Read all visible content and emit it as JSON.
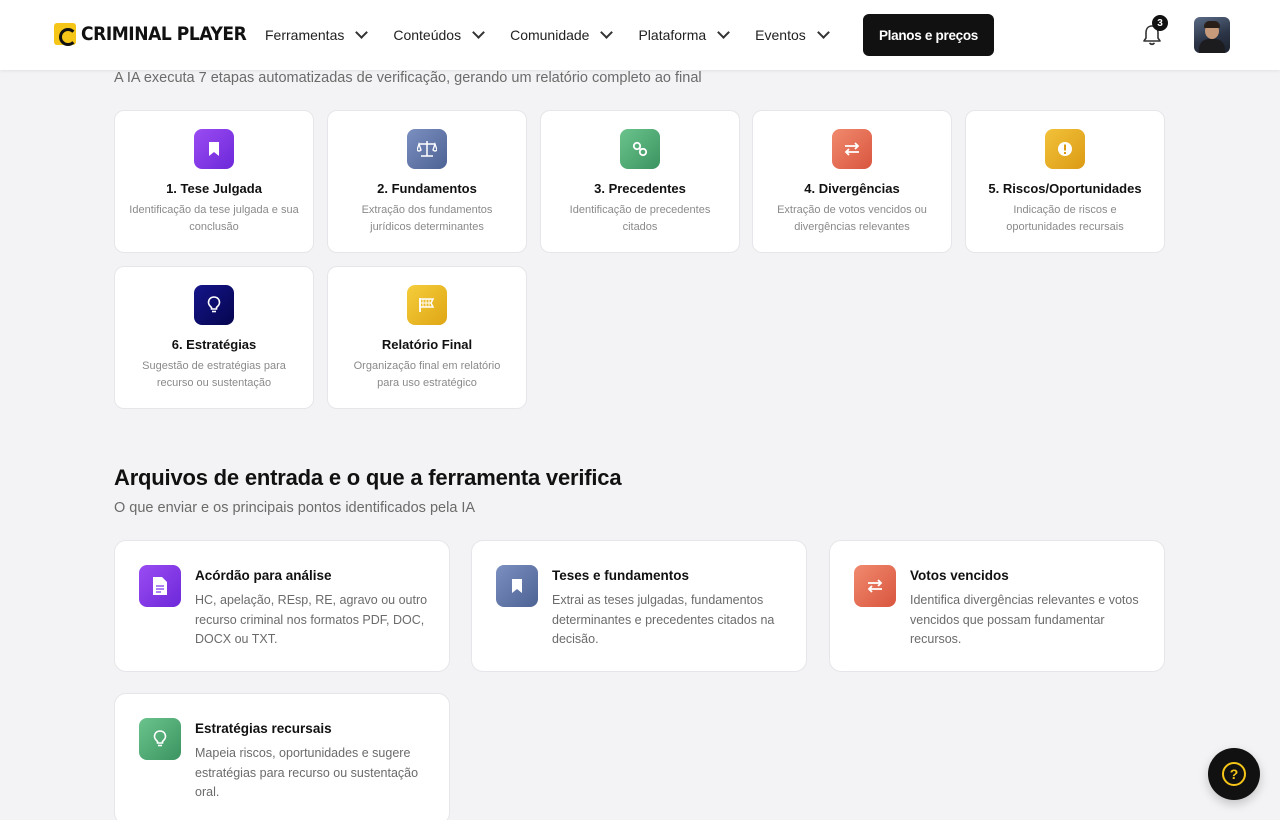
{
  "header": {
    "logo_text": "CRIMINAL PLAYER",
    "nav": [
      "Ferramentas",
      "Conteúdos",
      "Comunidade",
      "Plataforma",
      "Eventos"
    ],
    "cta": "Planos e preços",
    "notification_count": "3"
  },
  "steps_intro": "A IA executa 7 etapas automatizadas de verificação, gerando um relatório completo ao final",
  "steps": [
    {
      "title": "1. Tese Julgada",
      "desc": "Identificação da tese julgada e sua conclusão",
      "icon": "bookmark-icon",
      "color": "#7c3aed"
    },
    {
      "title": "2. Fundamentos",
      "desc": "Extração dos fundamentos jurídicos determinantes",
      "icon": "scale-icon",
      "color": "#5b73a8"
    },
    {
      "title": "3. Precedentes",
      "desc": "Identificação de precedentes citados",
      "icon": "link-icon",
      "color": "#4aa36b"
    },
    {
      "title": "4. Divergências",
      "desc": "Extração de votos vencidos ou divergências relevantes",
      "icon": "swap-icon",
      "color": "#e0674f"
    },
    {
      "title": "5. Riscos/Oportunidades",
      "desc": "Indicação de riscos e oportunidades recursais",
      "icon": "alert-icon",
      "color": "#e4a820"
    },
    {
      "title": "6. Estratégias",
      "desc": "Sugestão de estratégias para recurso ou sustentação",
      "icon": "lightbulb-icon",
      "color": "#0b0b6e"
    },
    {
      "title": "Relatório Final",
      "desc": "Organização final em relatório para uso estratégico",
      "icon": "flag-icon",
      "color": "#e4b320"
    }
  ],
  "files_section": {
    "title": "Arquivos de entrada e o que a ferramenta verifica",
    "subtitle": "O que enviar e os principais pontos identificados pela IA",
    "cards": [
      {
        "title": "Acórdão para análise",
        "desc": "HC, apelação, REsp, RE, agravo ou outro recurso criminal nos formatos PDF, DOC, DOCX ou TXT.",
        "icon": "document-icon",
        "color": "#7c3aed"
      },
      {
        "title": "Teses e fundamentos",
        "desc": "Extrai as teses julgadas, fundamentos determinantes e precedentes citados na decisão.",
        "icon": "bookmark-icon",
        "color": "#5b73a8"
      },
      {
        "title": "Votos vencidos",
        "desc": "Identifica divergências relevantes e votos vencidos que possam fundamentar recursos.",
        "icon": "swap-icon",
        "color": "#e0674f"
      },
      {
        "title": "Estratégias recursais",
        "desc": "Mapeia riscos, oportunidades e sugere estratégias para recurso ou sustentação oral.",
        "icon": "lightbulb-icon",
        "color": "#4aa36b"
      }
    ]
  }
}
